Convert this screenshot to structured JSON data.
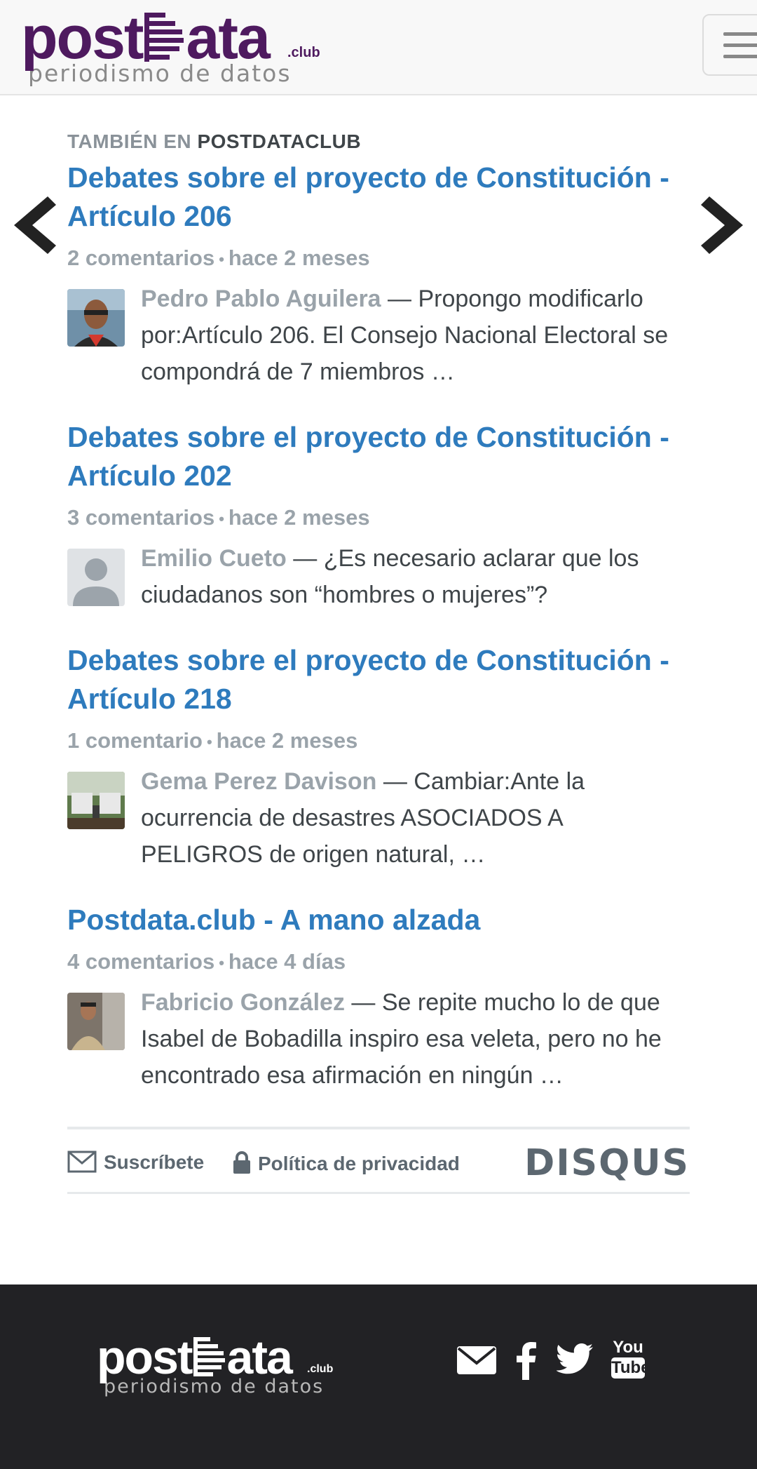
{
  "header": {
    "logo_text_left": "post",
    "logo_text_right": "ata",
    "logo_suffix": ".club",
    "logo_tagline": "periodismo de datos",
    "menu_icon": "hamburger-menu-icon"
  },
  "recommendations": {
    "heading_prefix": "TAMBIÉN EN",
    "heading_site": "POSTDATACLUB",
    "prev_icon": "chevron-left-icon",
    "next_icon": "chevron-right-icon",
    "articles": [
      {
        "title": "Debates sobre el proyecto de Constitución - Artículo 206",
        "comments": "2 comentarios",
        "time": "hace 2 meses",
        "author": "Pedro Pablo Aguilera",
        "excerpt": " — Propongo modificarlo por:Artículo 206. El Consejo Nacional Electoral se compondrá de 7 miembros …"
      },
      {
        "title": "Debates sobre el proyecto de Constitución - Artículo 202",
        "comments": "3 comentarios",
        "time": "hace 2 meses",
        "author": "Emilio Cueto",
        "excerpt": " — ¿Es necesario aclarar que los ciudadanos son “hombres o mujeres”?"
      },
      {
        "title": "Debates sobre el proyecto de Constitución - Artículo 218",
        "comments": "1 comentario",
        "time": "hace 2 meses",
        "author": "Gema Perez Davison",
        "excerpt": " — Cambiar:Ante la ocurrencia de desastres ASOCIADOS A PELIGROS de origen natural, …"
      },
      {
        "title": "Postdata.club - A mano alzada",
        "comments": "4 comentarios",
        "time": "hace 4 días",
        "author": "Fabricio González",
        "excerpt": " — Se repite mucho lo de que Isabel de Bobadilla inspiro esa veleta, pero no he encontrado esa afirmación en ningún …"
      }
    ]
  },
  "disqus_footer": {
    "subscribe": "Suscríbete",
    "privacy": "Política de privacidad",
    "brand": "DISQUS"
  },
  "site_footer": {
    "logo_text_left": "post",
    "logo_text_right": "ata",
    "logo_suffix": ".club",
    "logo_tagline": "periodismo de datos",
    "social_icons": [
      "email-icon",
      "facebook-icon",
      "twitter-icon",
      "youtube-icon"
    ],
    "youtube_top": "You",
    "youtube_bottom": "Tube"
  },
  "colors": {
    "brand_purple": "#4e1a5f",
    "link_blue": "#2e7bbd",
    "meta_gray": "#9aa3aa",
    "footer_bg": "#222225"
  }
}
